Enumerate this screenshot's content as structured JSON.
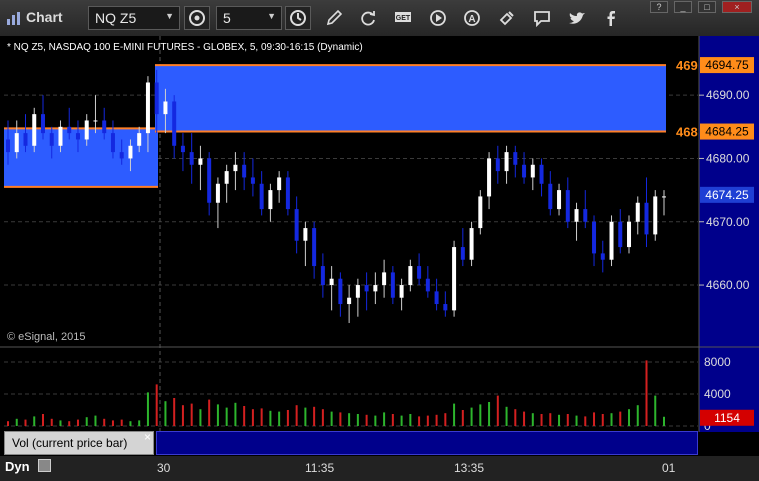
{
  "window": {
    "title": "Chart",
    "symbol": "NQ Z5",
    "interval": "5",
    "tools": [
      "interval-settings-icon",
      "clock-icon",
      "pencil-icon",
      "refresh-icon",
      "get-icon",
      "play-icon",
      "alert-icon",
      "link-icon",
      "chat-icon",
      "twitter-icon",
      "facebook-icon"
    ],
    "controls": [
      "?",
      "_",
      "□",
      "×"
    ]
  },
  "chart_header": "* NQ Z5, NASDAQ 100 E-MINI FUTURES - GLOBEX, 5, 09:30-16:15 (Dynamic)",
  "copyright": "© eSignal, 2015",
  "colors": {
    "up": "#ffffff",
    "down": "#1428e0",
    "zone": "#2d5cff",
    "level_line": "#ff7f27",
    "price_tag": "#ff8c1a",
    "current_tag": "#1f3fd4",
    "vol_up": "#2db52d",
    "vol_down": "#d42020"
  },
  "price_axis": {
    "ticks": [
      "4690.00",
      "4680.00",
      "4670.00",
      "4660.00"
    ],
    "level_upper": "4694.75",
    "level_lower": "4684.25",
    "current": "4674.25",
    "level_upper_clipped": "469",
    "level_lower_clipped": "468"
  },
  "volume_axis": {
    "ticks": [
      "8000",
      "4000",
      "0"
    ],
    "current": "1154"
  },
  "volume_panel": {
    "label": "Vol (current price bar)",
    "close": "×"
  },
  "bottom": {
    "dyn": "Dyn",
    "x_labels": [
      "30",
      "11:35",
      "13:35",
      "01"
    ]
  },
  "chart_data": {
    "type": "candlestick",
    "price_ylim": [
      4652,
      4698
    ],
    "volume_ylim": [
      0,
      9000
    ],
    "levels": [
      4694.75,
      4684.25
    ],
    "current_price": 4674.25,
    "candles": [
      [
        4683,
        4686,
        4679,
        4681,
        600
      ],
      [
        4681,
        4686,
        4680,
        4684,
        900
      ],
      [
        4684,
        4687,
        4681,
        4682,
        800
      ],
      [
        4682,
        4688,
        4681,
        4687,
        1200
      ],
      [
        4687,
        4690,
        4683,
        4684,
        1500
      ],
      [
        4684,
        4685,
        4680,
        4682,
        900
      ],
      [
        4682,
        4686,
        4681,
        4685,
        700
      ],
      [
        4685,
        4688,
        4683,
        4684,
        600
      ],
      [
        4684,
        4686,
        4681,
        4683,
        800
      ],
      [
        4683,
        4687,
        4682,
        4686,
        1100
      ],
      [
        4686,
        4690,
        4684,
        4686,
        1300
      ],
      [
        4686,
        4688,
        4683,
        4684,
        900
      ],
      [
        4684,
        4686,
        4680,
        4681,
        700
      ],
      [
        4681,
        4683,
        4679,
        4680,
        800
      ],
      [
        4680,
        4683,
        4678,
        4682,
        600
      ],
      [
        4682,
        4685,
        4681,
        4684,
        700
      ],
      [
        4684,
        4693,
        4681,
        4692,
        4200
      ],
      [
        4692,
        4694,
        4684,
        4687,
        5200
      ],
      [
        4687,
        4691,
        4684,
        4689,
        3100
      ],
      [
        4689,
        4690,
        4680,
        4682,
        3500
      ],
      [
        4682,
        4684,
        4678,
        4681,
        2600
      ],
      [
        4681,
        4684,
        4676,
        4679,
        2800
      ],
      [
        4679,
        4682,
        4675,
        4680,
        2100
      ],
      [
        4680,
        4681,
        4671,
        4673,
        3300
      ],
      [
        4673,
        4677,
        4669,
        4676,
        2700
      ],
      [
        4676,
        4679,
        4673,
        4678,
        2300
      ],
      [
        4678,
        4681,
        4675,
        4679,
        2900
      ],
      [
        4679,
        4681,
        4675,
        4677,
        2500
      ],
      [
        4677,
        4680,
        4674,
        4676,
        2100
      ],
      [
        4676,
        4678,
        4671,
        4672,
        2200
      ],
      [
        4672,
        4676,
        4670,
        4675,
        1900
      ],
      [
        4675,
        4678,
        4673,
        4677,
        1800
      ],
      [
        4677,
        4678,
        4671,
        4672,
        2000
      ],
      [
        4672,
        4674,
        4665,
        4667,
        2600
      ],
      [
        4667,
        4670,
        4663,
        4669,
        2300
      ],
      [
        4669,
        4670,
        4661,
        4663,
        2400
      ],
      [
        4663,
        4665,
        4658,
        4660,
        2100
      ],
      [
        4660,
        4663,
        4656,
        4661,
        1800
      ],
      [
        4661,
        4662,
        4655,
        4657,
        1700
      ],
      [
        4657,
        4660,
        4654,
        4658,
        1600
      ],
      [
        4658,
        4661,
        4655,
        4660,
        1500
      ],
      [
        4660,
        4662,
        4656,
        4659,
        1400
      ],
      [
        4659,
        4662,
        4657,
        4660,
        1300
      ],
      [
        4660,
        4664,
        4658,
        4662,
        1700
      ],
      [
        4662,
        4663,
        4657,
        4658,
        1500
      ],
      [
        4658,
        4661,
        4656,
        4660,
        1300
      ],
      [
        4660,
        4664,
        4659,
        4663,
        1500
      ],
      [
        4663,
        4665,
        4660,
        4661,
        1200
      ],
      [
        4661,
        4663,
        4658,
        4659,
        1300
      ],
      [
        4659,
        4661,
        4656,
        4657,
        1400
      ],
      [
        4657,
        4659,
        4655,
        4656,
        1600
      ],
      [
        4656,
        4667,
        4655,
        4666,
        2800
      ],
      [
        4666,
        4669,
        4663,
        4664,
        2000
      ],
      [
        4664,
        4670,
        4663,
        4669,
        2300
      ],
      [
        4669,
        4675,
        4668,
        4674,
        2700
      ],
      [
        4674,
        4681,
        4672,
        4680,
        3000
      ],
      [
        4680,
        4682,
        4676,
        4678,
        3800
      ],
      [
        4678,
        4682,
        4676,
        4681,
        2400
      ],
      [
        4681,
        4682,
        4677,
        4679,
        2100
      ],
      [
        4679,
        4681,
        4676,
        4677,
        1800
      ],
      [
        4677,
        4680,
        4675,
        4679,
        1600
      ],
      [
        4679,
        4680,
        4674,
        4676,
        1500
      ],
      [
        4676,
        4678,
        4671,
        4672,
        1600
      ],
      [
        4672,
        4676,
        4671,
        4675,
        1400
      ],
      [
        4675,
        4677,
        4669,
        4670,
        1500
      ],
      [
        4670,
        4673,
        4667,
        4672,
        1300
      ],
      [
        4672,
        4675,
        4669,
        4670,
        1200
      ],
      [
        4670,
        4671,
        4663,
        4665,
        1700
      ],
      [
        4665,
        4667,
        4662,
        4664,
        1500
      ],
      [
        4664,
        4671,
        4663,
        4670,
        1600
      ],
      [
        4670,
        4672,
        4665,
        4666,
        1800
      ],
      [
        4666,
        4671,
        4665,
        4670,
        2100
      ],
      [
        4670,
        4674,
        4668,
        4673,
        2600
      ],
      [
        4673,
        4677,
        4666,
        4668,
        8200
      ],
      [
        4668,
        4675,
        4667,
        4674,
        3800
      ],
      [
        4674,
        4675,
        4671,
        4674,
        1154
      ]
    ],
    "ylabel": ""
  }
}
